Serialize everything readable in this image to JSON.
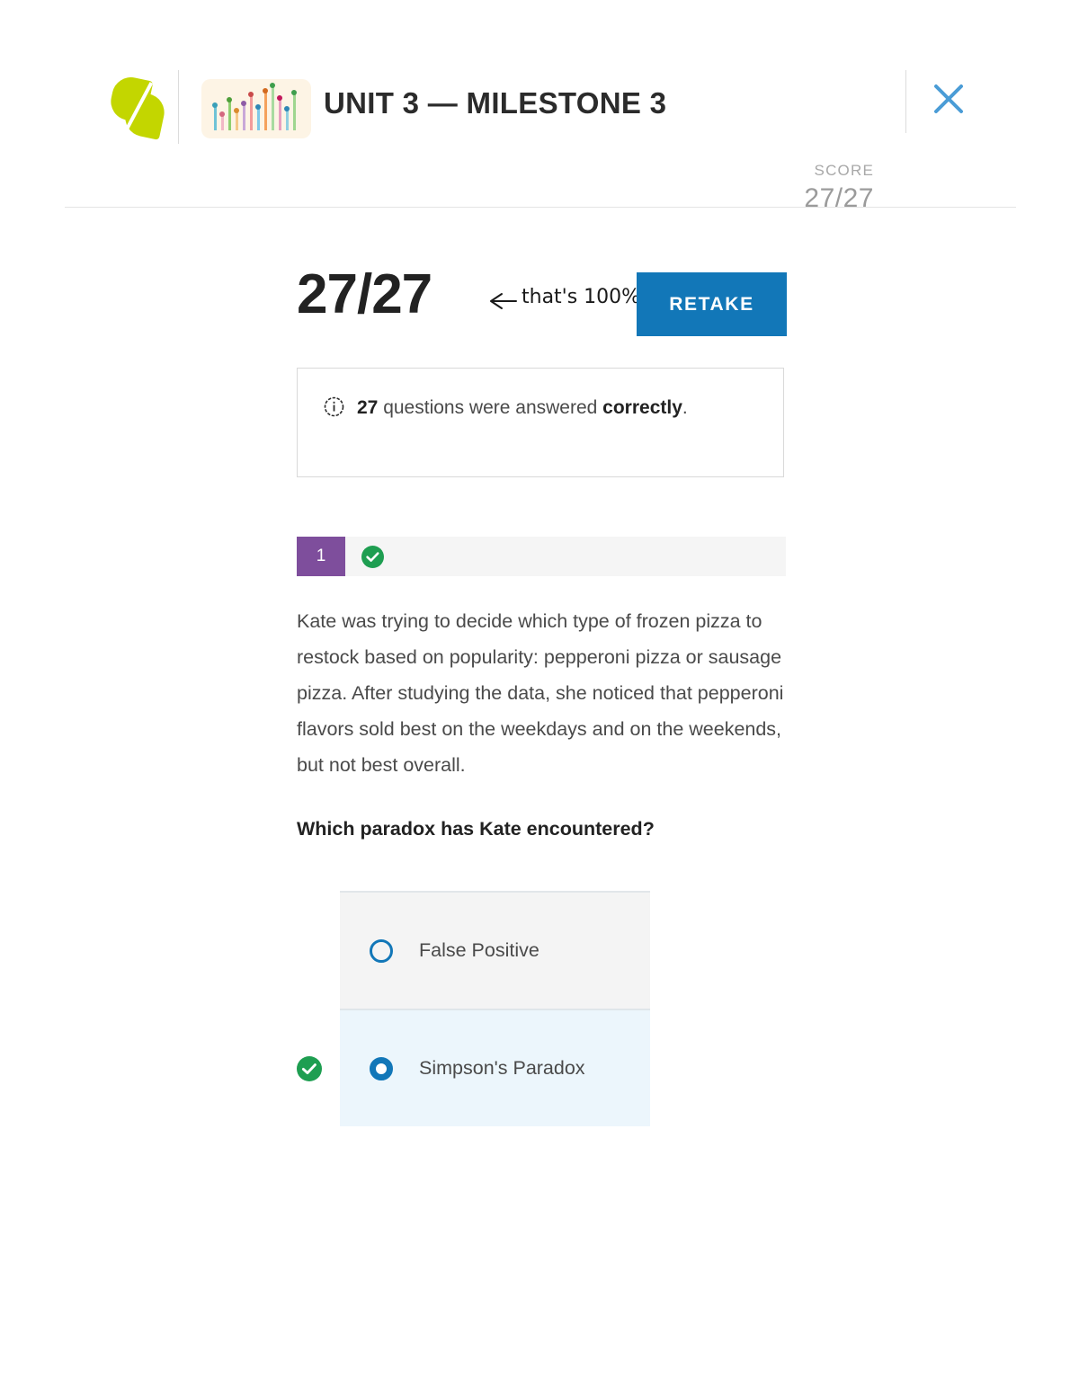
{
  "header": {
    "logo_icon": "sophia-leaf-logo",
    "course_icon": "lollipop-chart-icon",
    "title": "UNIT 3 — MILESTONE 3",
    "close_icon": "close-x-icon",
    "score_label": "SCORE",
    "score_value": "27/27"
  },
  "result": {
    "big_score": "27/27",
    "annotation": "that's 100%",
    "annotation_arrow_icon": "left-arrow-icon",
    "retake_label": "RETAKE",
    "info_icon": "info-circle-icon",
    "info_count": "27",
    "info_text_mid": " questions were answered ",
    "info_emphasis": "correctly",
    "info_text_end": "."
  },
  "question": {
    "number": "1",
    "status_icon": "check-circle-icon",
    "body": "Kate was trying to decide which type of frozen pizza to restock based on popularity: pepperoni pizza or sausage pizza. After studying the data, she noticed that pepperoni flavors sold best on the weekdays and on the weekends, but not best overall.",
    "prompt": "Which paradox has Kate encountered?",
    "options": [
      {
        "label": "False Positive",
        "selected": false,
        "correct": false
      },
      {
        "label": "Simpson's Paradox",
        "selected": true,
        "correct": true
      }
    ],
    "correct_badge_icon": "check-circle-icon"
  },
  "colors": {
    "brand_green": "#c3d600",
    "accent_blue": "#1277b8",
    "purple": "#7e4e9c",
    "success_green": "#1e9e51",
    "selected_bg": "#ecf6fc",
    "option_bg": "#f4f4f4"
  }
}
